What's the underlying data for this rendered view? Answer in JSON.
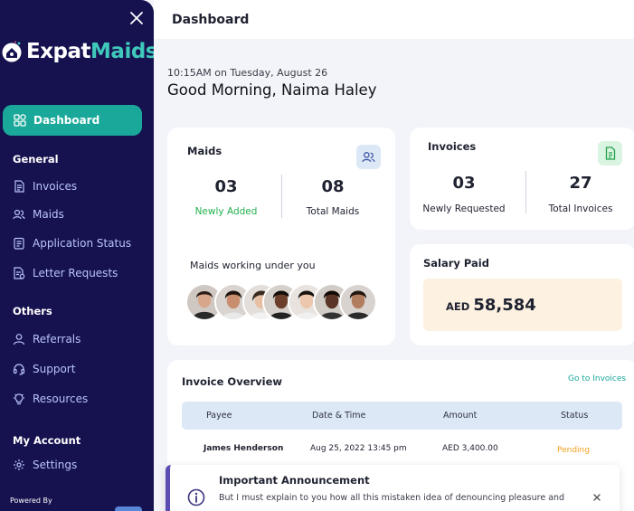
{
  "sidebar": {
    "logo": {
      "word1": "Expat",
      "word2": "Maids"
    },
    "active_item": {
      "label": "Dashboard",
      "icon": "grid-icon"
    },
    "sections": {
      "general": "General",
      "others": "Others",
      "my_account": "My Account"
    },
    "items": [
      {
        "label": "Invoices",
        "icon": "document-icon"
      },
      {
        "label": "Maids",
        "icon": "users-icon"
      },
      {
        "label": "Application Status",
        "icon": "clipboard-icon"
      },
      {
        "label": "Letter Requests",
        "icon": "letter-icon"
      },
      {
        "label": "Referrals",
        "icon": "user-icon"
      },
      {
        "label": "Support",
        "icon": "headset-icon"
      },
      {
        "label": "Resources",
        "icon": "lightbulb-icon"
      },
      {
        "label": "Settings",
        "icon": "gear-icon"
      }
    ],
    "powered_by": "Powered By"
  },
  "header": {
    "title": "Dashboard"
  },
  "greeting": {
    "timestamp": "10:15AM on Tuesday, August 26",
    "text": "Good Morning, Naima Haley"
  },
  "maids_card": {
    "title": "Maids",
    "stats": [
      {
        "value": "03",
        "label": "Newly Added"
      },
      {
        "value": "08",
        "label": "Total Maids"
      }
    ],
    "working_label": "Maids working under you"
  },
  "invoices_card": {
    "title": "Invoices",
    "stats": [
      {
        "value": "03",
        "label": "Newly Requested"
      },
      {
        "value": "27",
        "label": "Total Invoices"
      }
    ]
  },
  "salary_card": {
    "title": "Salary Paid",
    "currency": "AED",
    "amount": "58,584"
  },
  "invoice_overview": {
    "title": "Invoice Overview",
    "link": "Go to Invoices",
    "columns": [
      "Payee",
      "Date & Time",
      "Amount",
      "Status"
    ],
    "rows": [
      {
        "payee": "James Henderson",
        "datetime": "Aug 25, 2022  13:45 pm",
        "amount": "AED 3,400.00",
        "status": "Pending"
      }
    ]
  },
  "announcement": {
    "title": "Important Announcement",
    "body": "But I must explain to you how all this mistaken idea of denouncing pleasure and"
  },
  "colors": {
    "sidebar_bg": "#16124f",
    "accent_teal": "#1aa89a",
    "pending": "#f0a020",
    "newly_added": "#22b14c"
  }
}
